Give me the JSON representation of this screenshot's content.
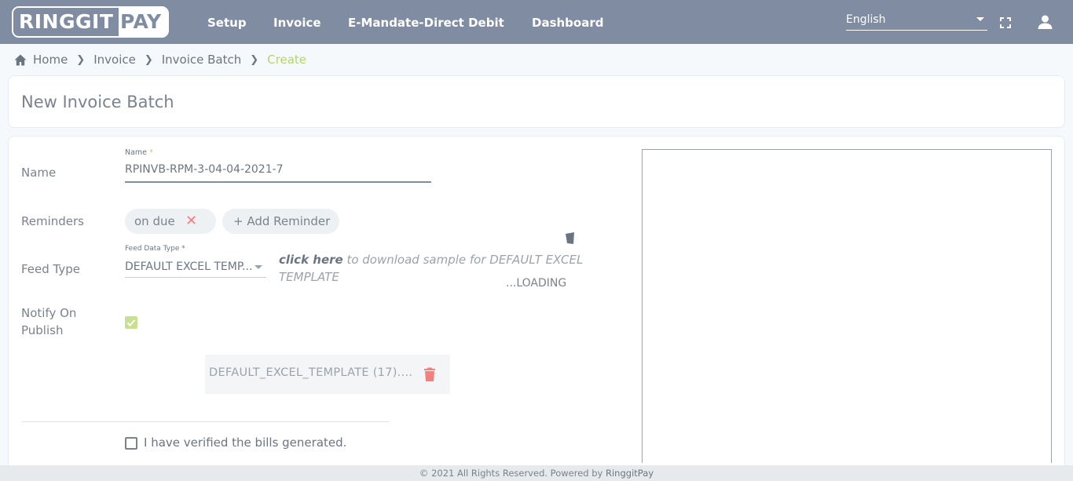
{
  "header": {
    "logo_left": "RINGGIT",
    "logo_right": "PAY",
    "nav": [
      "Setup",
      "Invoice",
      "E-Mandate-Direct Debit",
      "Dashboard"
    ],
    "language": "English"
  },
  "breadcrumb": {
    "items": [
      "Home",
      "Invoice",
      "Invoice Batch"
    ],
    "active": "Create"
  },
  "page_title": "New Invoice Batch",
  "form": {
    "name_label": "Name",
    "name_field_label": "Name",
    "name_required": "*",
    "name_value": "RPINVB-RPM-3-04-04-2021-7",
    "reminders_label": "Reminders",
    "reminder_chip": "on due",
    "reminder_remove": "✕",
    "add_reminder": "+ Add Reminder",
    "feed_type_label": "Feed Type",
    "feed_field_label": "Feed Data Type",
    "feed_required": "*",
    "feed_value": "DEFAULT EXCEL TEMP...",
    "download_link": "click here",
    "download_text": " to download sample for DEFAULT EXCEL TEMPLATE",
    "loading": "...LOADING",
    "notify_label": "Notify On Publish",
    "notify_checked": true,
    "file_name": "DEFAULT_EXCEL_TEMPLATE (17)....",
    "verify_label": "I have verified the bills generated."
  },
  "footer": {
    "text": "© 2021 All Rights Reserved. Powered by ",
    "brand": "RinggitPay"
  },
  "colors": {
    "header_bg": "#7f8ca1",
    "accent_green": "#b5d46f",
    "delete_red": "#f37f7f"
  }
}
